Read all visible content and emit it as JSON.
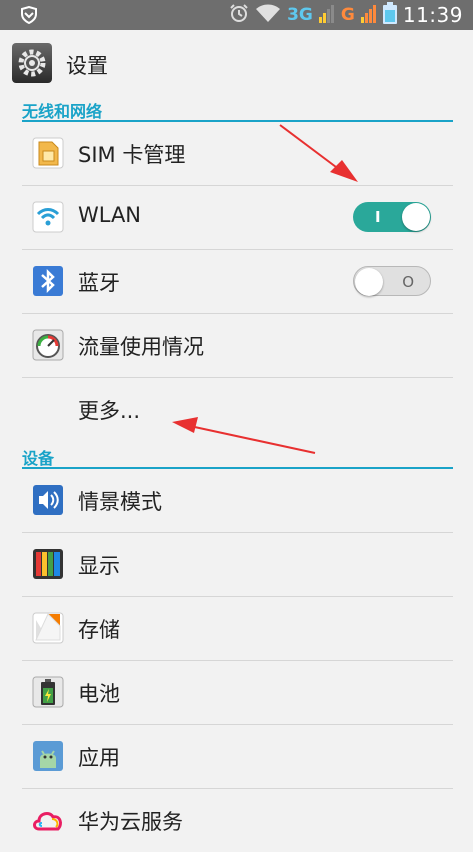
{
  "status_bar": {
    "network_3g": "3G",
    "network_g": "G",
    "time": "11:39"
  },
  "app_bar": {
    "title": "设置",
    "icon": "gear-icon"
  },
  "sections": {
    "wireless": {
      "header": "无线和网络",
      "items": [
        {
          "label": "SIM 卡管理",
          "icon": "sim-card-icon"
        },
        {
          "label": "WLAN",
          "icon": "wifi-icon",
          "toggle": "I",
          "toggle_on": true
        },
        {
          "label": "蓝牙",
          "icon": "bluetooth-icon",
          "toggle": "O",
          "toggle_on": false
        },
        {
          "label": "流量使用情况",
          "icon": "data-usage-icon"
        },
        {
          "label": "更多..."
        }
      ]
    },
    "device": {
      "header": "设备",
      "items": [
        {
          "label": "情景模式",
          "icon": "sound-profile-icon"
        },
        {
          "label": "显示",
          "icon": "display-icon"
        },
        {
          "label": "存储",
          "icon": "storage-icon"
        },
        {
          "label": "电池",
          "icon": "battery-icon"
        },
        {
          "label": "应用",
          "icon": "apps-icon"
        },
        {
          "label": "华为云服务",
          "icon": "cloud-icon"
        }
      ]
    }
  },
  "colors": {
    "accent": "#1aa3c8",
    "toggle_on": "#2aa89a",
    "annotation_arrow": "#e83030"
  }
}
